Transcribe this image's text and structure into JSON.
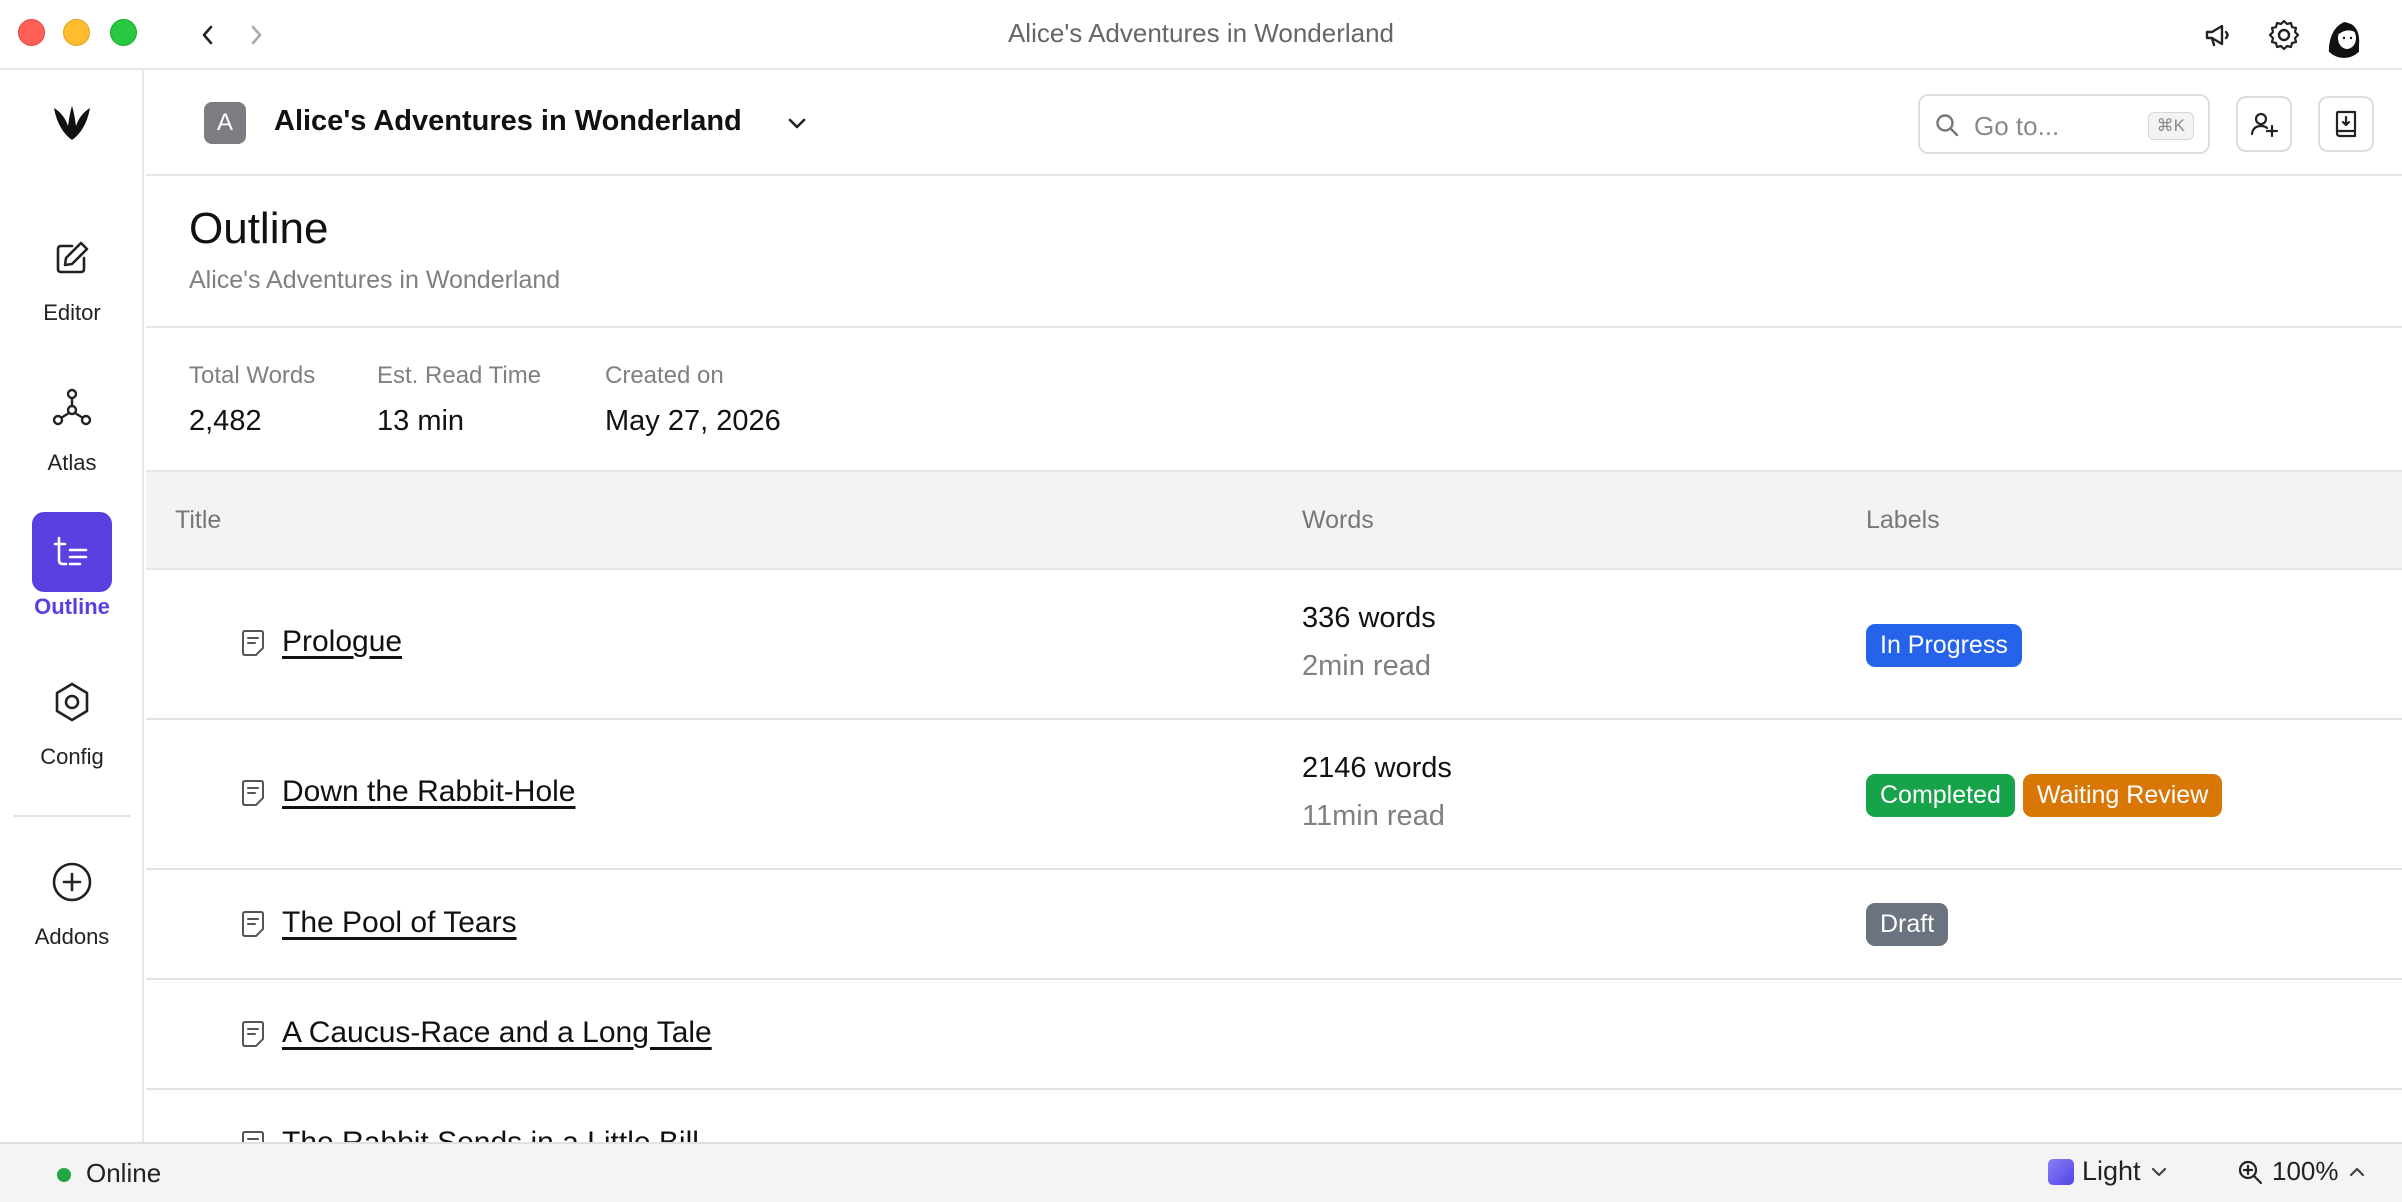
{
  "window": {
    "title": "Alice's Adventures in Wonderland"
  },
  "sidebar": {
    "items": [
      {
        "label": "Editor",
        "icon": "edit-icon",
        "active": false
      },
      {
        "label": "Atlas",
        "icon": "atlas-icon",
        "active": false
      },
      {
        "label": "Outline",
        "icon": "outline-icon",
        "active": true
      },
      {
        "label": "Config",
        "icon": "config-icon",
        "active": false
      },
      {
        "label": "Addons",
        "icon": "add-circle-icon",
        "active": false
      }
    ]
  },
  "header": {
    "project_initial": "A",
    "project_name": "Alice's Adventures in Wonderland",
    "search_placeholder": "Go to...",
    "search_shortcut": "⌘K"
  },
  "page": {
    "title": "Outline",
    "subtitle": "Alice's Adventures in Wonderland"
  },
  "stats": [
    {
      "label": "Total Words",
      "value": "2,482"
    },
    {
      "label": "Est. Read Time",
      "value": "13 min"
    },
    {
      "label": "Created on",
      "value": "May 27, 2026"
    }
  ],
  "table": {
    "columns": [
      "Title",
      "Words",
      "Labels"
    ],
    "rows": [
      {
        "title": "Prologue",
        "words": "336 words",
        "read": "2min read",
        "labels": [
          {
            "text": "In Progress",
            "color": "#2563eb"
          }
        ]
      },
      {
        "title": "Down the Rabbit-Hole",
        "words": "2146 words",
        "read": "11min read",
        "labels": [
          {
            "text": "Completed",
            "color": "#16a34a"
          },
          {
            "text": "Waiting Review",
            "color": "#d97706"
          }
        ]
      },
      {
        "title": "The Pool of Tears",
        "words": "",
        "read": "",
        "labels": [
          {
            "text": "Draft",
            "color": "#6b7280"
          }
        ]
      },
      {
        "title": "A Caucus-Race and a Long Tale",
        "words": "",
        "read": "",
        "labels": []
      },
      {
        "title": "The Rabbit Sends in a Little Bill",
        "words": "",
        "read": "",
        "labels": []
      }
    ]
  },
  "statusbar": {
    "connection": "Online",
    "connection_color": "#22a447",
    "theme": "Light",
    "zoom": "100%"
  },
  "colors": {
    "accent": "#5b3fe0"
  }
}
